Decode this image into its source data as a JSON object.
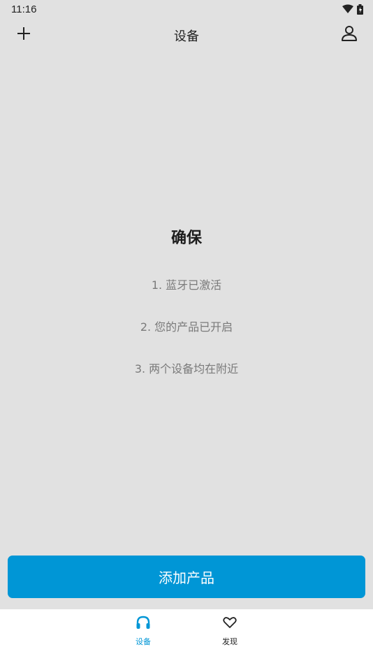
{
  "status_bar": {
    "time": "11:16",
    "icons": [
      "wifi-icon",
      "battery-icon"
    ]
  },
  "app_bar": {
    "title": "设备",
    "left_icon": "plus-icon",
    "right_icon": "user-icon"
  },
  "empty_state": {
    "heading": "确保",
    "hints": [
      "1. 蓝牙已激活",
      "2. 您的产品已开启",
      "3. 两个设备均在附近"
    ]
  },
  "primary_action": {
    "label": "添加产品"
  },
  "bottom_nav": {
    "items": [
      {
        "label": "设备",
        "icon": "headphones-icon",
        "active": true
      },
      {
        "label": "发现",
        "icon": "heart-icon",
        "active": false
      }
    ]
  },
  "colors": {
    "background": "#e1e1e1",
    "accent": "#0096d6",
    "nav_background": "#ffffff",
    "hint_text": "#7a7a7a"
  }
}
